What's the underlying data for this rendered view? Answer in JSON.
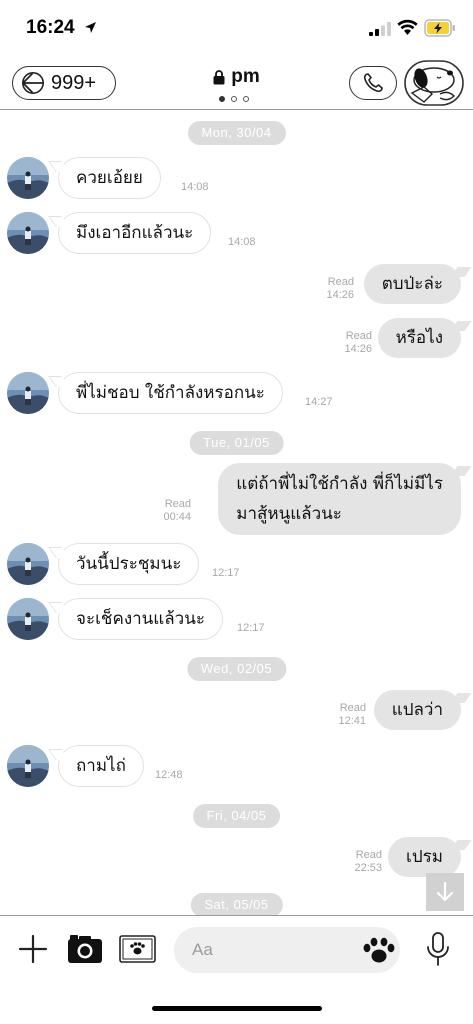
{
  "status_bar": {
    "time": "16:24"
  },
  "header": {
    "back_count": "999+",
    "title": "pm",
    "page_count": 3,
    "active_page": 0
  },
  "input": {
    "placeholder": "Aa"
  },
  "messages": [
    {
      "type": "date",
      "text": "Mon, 30/04"
    },
    {
      "type": "in",
      "text": "ควยเอ้ยย",
      "time": "14:08"
    },
    {
      "type": "in",
      "text": "มึงเอาอีกแล้วนะ",
      "time": "14:08"
    },
    {
      "type": "out",
      "text": "ตบป่ะล่ะ",
      "read": "Read",
      "time": "14:26"
    },
    {
      "type": "out",
      "text": "หรือไง",
      "read": "Read",
      "time": "14:26"
    },
    {
      "type": "in",
      "text": "พี่ไม่ชอบ ใช้กำลังหรอกนะ",
      "time": "14:27"
    },
    {
      "type": "date",
      "text": "Tue, 01/05"
    },
    {
      "type": "out",
      "text": "แต่ถ้าพี่ไม่ใช้กำลัง พี่ก็ไม่มีไร\nมาสู้หนูแล้วนะ",
      "read": "Read",
      "time": "00:44"
    },
    {
      "type": "in",
      "text": "วันนี้ประชุมนะ",
      "time": "12:17"
    },
    {
      "type": "in",
      "text": "จะเช็คงานแล้วนะ",
      "time": "12:17"
    },
    {
      "type": "date",
      "text": "Wed, 02/05"
    },
    {
      "type": "out",
      "text": "แปลว่า",
      "read": "Read",
      "time": "12:41"
    },
    {
      "type": "in",
      "text": "ถามไถ่",
      "time": "12:48"
    },
    {
      "type": "date",
      "text": "Fri, 04/05"
    },
    {
      "type": "out",
      "text": "เปรม",
      "read": "Read",
      "time": "22:53"
    },
    {
      "type": "date",
      "text": "Sat, 05/05"
    }
  ]
}
